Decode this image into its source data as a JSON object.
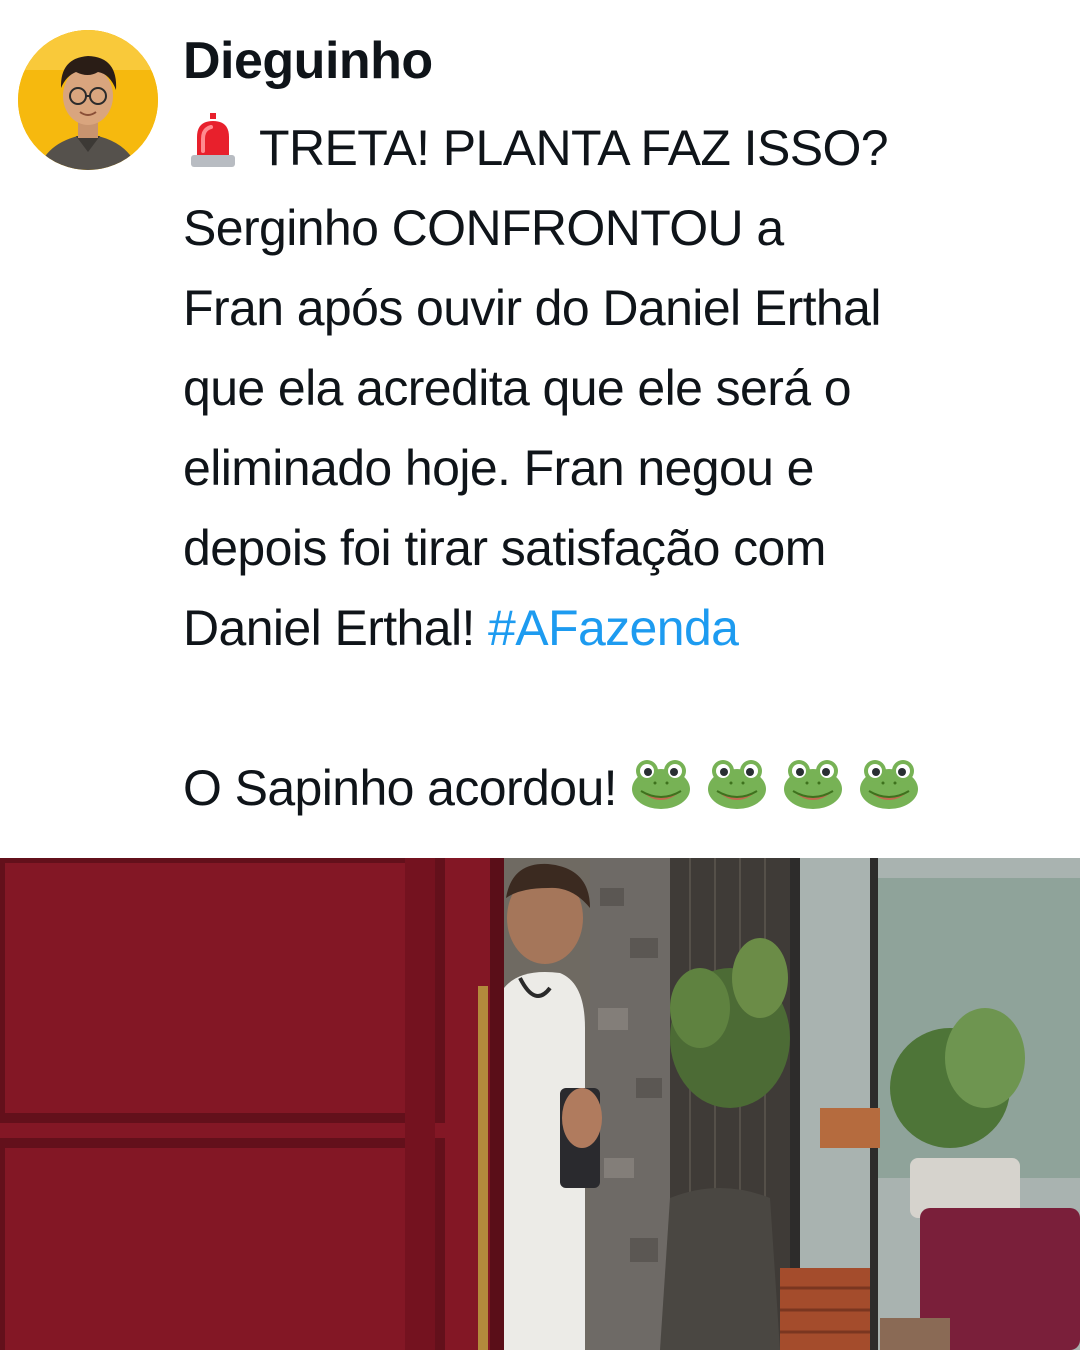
{
  "post": {
    "author": "Dieguinho",
    "avatar_icon": "avatar-photo",
    "alert_icon": "police-light-icon",
    "text_lines": [
      "TRETA! PLANTA FAZ ISSO?",
      "Serginho CONFRONTOU a",
      "Fran após ouvir do Daniel Erthal",
      "que ela acredita que ele será o",
      "eliminado hoje. Fran negou e",
      "depois foi tirar satisfação com",
      "Daniel Erthal! "
    ],
    "hashtag": "#AFazenda",
    "closing_text": "O Sapinho acordou!",
    "emoji_icon": "frog-face-icon",
    "emoji_count": 4
  },
  "media": {
    "type": "video-frame",
    "description_icon": "video-still-image"
  },
  "colors": {
    "text": "#0f1419",
    "hashtag": "#1d9bf0",
    "background": "#ffffff",
    "avatar_background": "#f5b400"
  }
}
